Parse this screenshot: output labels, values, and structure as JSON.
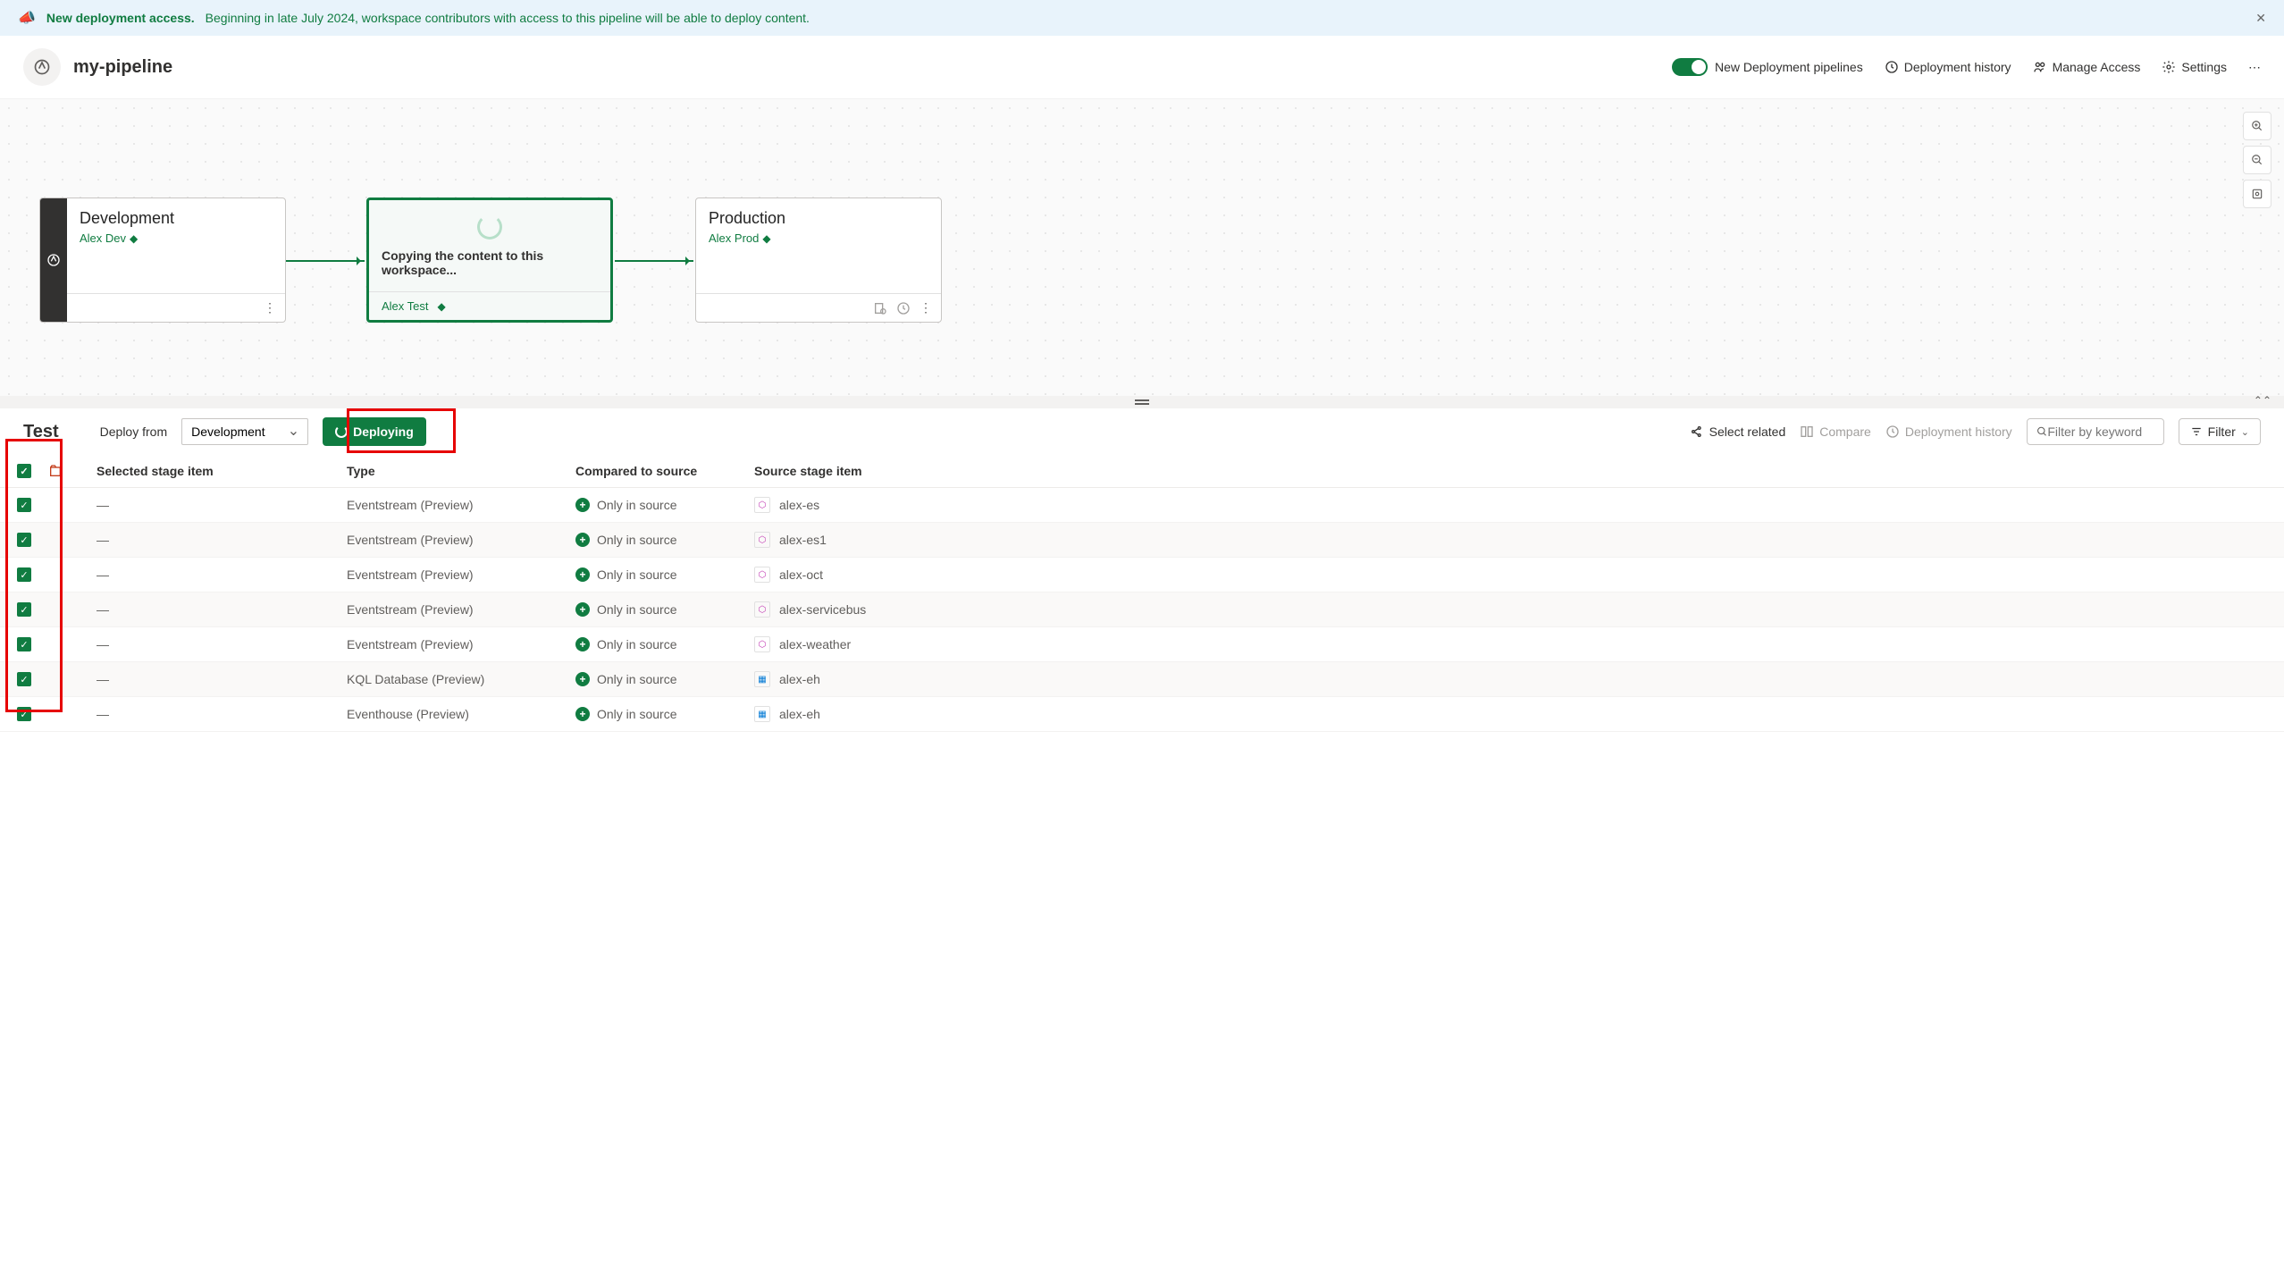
{
  "banner": {
    "title": "New deployment access.",
    "message": "Beginning in late July 2024, workspace contributors with access to this pipeline will be able to deploy content."
  },
  "header": {
    "title": "my-pipeline",
    "toggle_label": "New Deployment pipelines",
    "history": "Deployment history",
    "access": "Manage Access",
    "settings": "Settings"
  },
  "stages": {
    "dev": {
      "name": "Development",
      "workspace": "Alex Dev"
    },
    "test": {
      "copying_msg": "Copying the content to this workspace...",
      "workspace": "Alex Test"
    },
    "prod": {
      "name": "Production",
      "workspace": "Alex Prod"
    }
  },
  "toolbar": {
    "stage_title": "Test",
    "deploy_from_label": "Deploy from",
    "deploy_from_value": "Development",
    "deploy_btn": "Deploying",
    "select_related": "Select related",
    "compare": "Compare",
    "deployment_history": "Deployment history",
    "search_placeholder": "Filter by keyword",
    "filter": "Filter"
  },
  "table": {
    "headers": {
      "selected": "Selected stage item",
      "type": "Type",
      "compared": "Compared to source",
      "source": "Source stage item"
    },
    "rows": [
      {
        "selected": "—",
        "type": "Eventstream (Preview)",
        "compared": "Only in source",
        "source": "alex-es",
        "icon": "es"
      },
      {
        "selected": "—",
        "type": "Eventstream (Preview)",
        "compared": "Only in source",
        "source": "alex-es1",
        "icon": "es"
      },
      {
        "selected": "—",
        "type": "Eventstream (Preview)",
        "compared": "Only in source",
        "source": "alex-oct",
        "icon": "es"
      },
      {
        "selected": "—",
        "type": "Eventstream (Preview)",
        "compared": "Only in source",
        "source": "alex-servicebus",
        "icon": "es"
      },
      {
        "selected": "—",
        "type": "Eventstream (Preview)",
        "compared": "Only in source",
        "source": "alex-weather",
        "icon": "es"
      },
      {
        "selected": "—",
        "type": "KQL Database (Preview)",
        "compared": "Only in source",
        "source": "alex-eh",
        "icon": "kql"
      },
      {
        "selected": "—",
        "type": "Eventhouse (Preview)",
        "compared": "Only in source",
        "source": "alex-eh",
        "icon": "kql"
      }
    ]
  }
}
